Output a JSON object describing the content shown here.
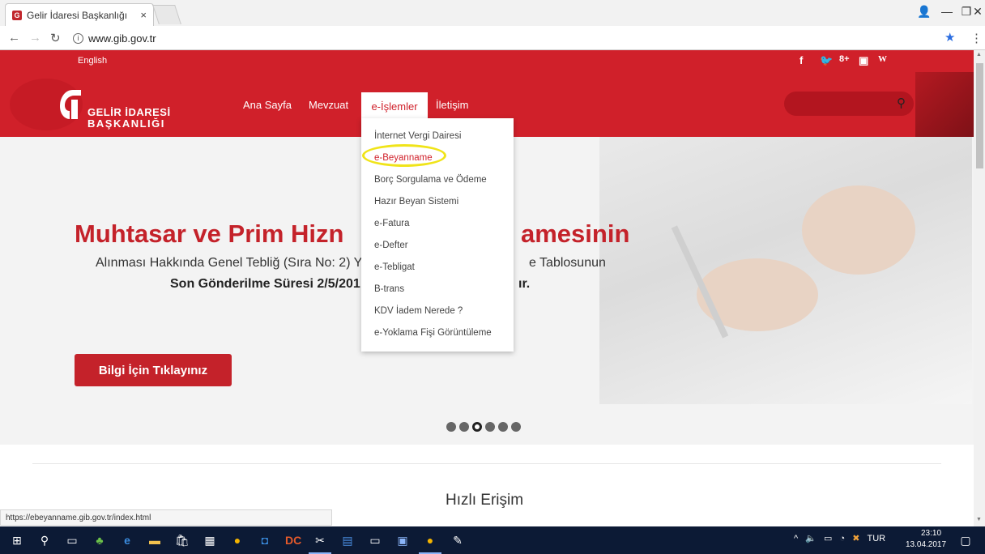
{
  "browser": {
    "tab_title": "Gelir İdaresi Başkanlığı",
    "tab_close": "×",
    "url": "www.gib.gov.tr",
    "status_url": "https://ebeyanname.gib.gov.tr/index.html"
  },
  "site": {
    "language_link": "English",
    "social": [
      "f",
      "🐦",
      "8+",
      "▣",
      "W"
    ],
    "logo_line1": "GELİR İDARESİ",
    "logo_line2": "BAŞKANLIĞI",
    "menu": {
      "home": "Ana Sayfa",
      "legislation": "Mevzuat",
      "eservices": "e-İşlemler",
      "contact": "İletişim"
    },
    "dropdown": [
      "İnternet Vergi Dairesi",
      "e-Beyanname",
      "Borç Sorgulama ve Ödeme",
      "Hazır Beyan Sistemi",
      "e-Fatura",
      "e-Defter",
      "e-Tebligat",
      "B-trans",
      "KDV İadem Nerede ?",
      "e-Yoklama Fişi Görüntüleme"
    ],
    "hero": {
      "headline_left": "Muhtasar ve Prim Hizn",
      "headline_right": "amesinin",
      "sub1_left": "Alınması Hakkında Genel Tebliğ (Sıra No: 2) Ya",
      "sub1_right": "e Tablosunun",
      "sub2_left": "Son Gönderilme Süresi 2/5/201",
      "sub2_right": "ır.",
      "cta": "Bilgi İçin Tıklayınız"
    },
    "slider": {
      "count": 6,
      "active_index": 2
    },
    "quick_access": "Hızlı Erişim"
  },
  "taskbar": {
    "tray_lang": "TUR",
    "time": "23:10",
    "date": "13.04.2017"
  },
  "colors": {
    "brand_red": "#d0202a",
    "highlight_circle": "#f0e419",
    "taskbar": "#0c1a35"
  }
}
